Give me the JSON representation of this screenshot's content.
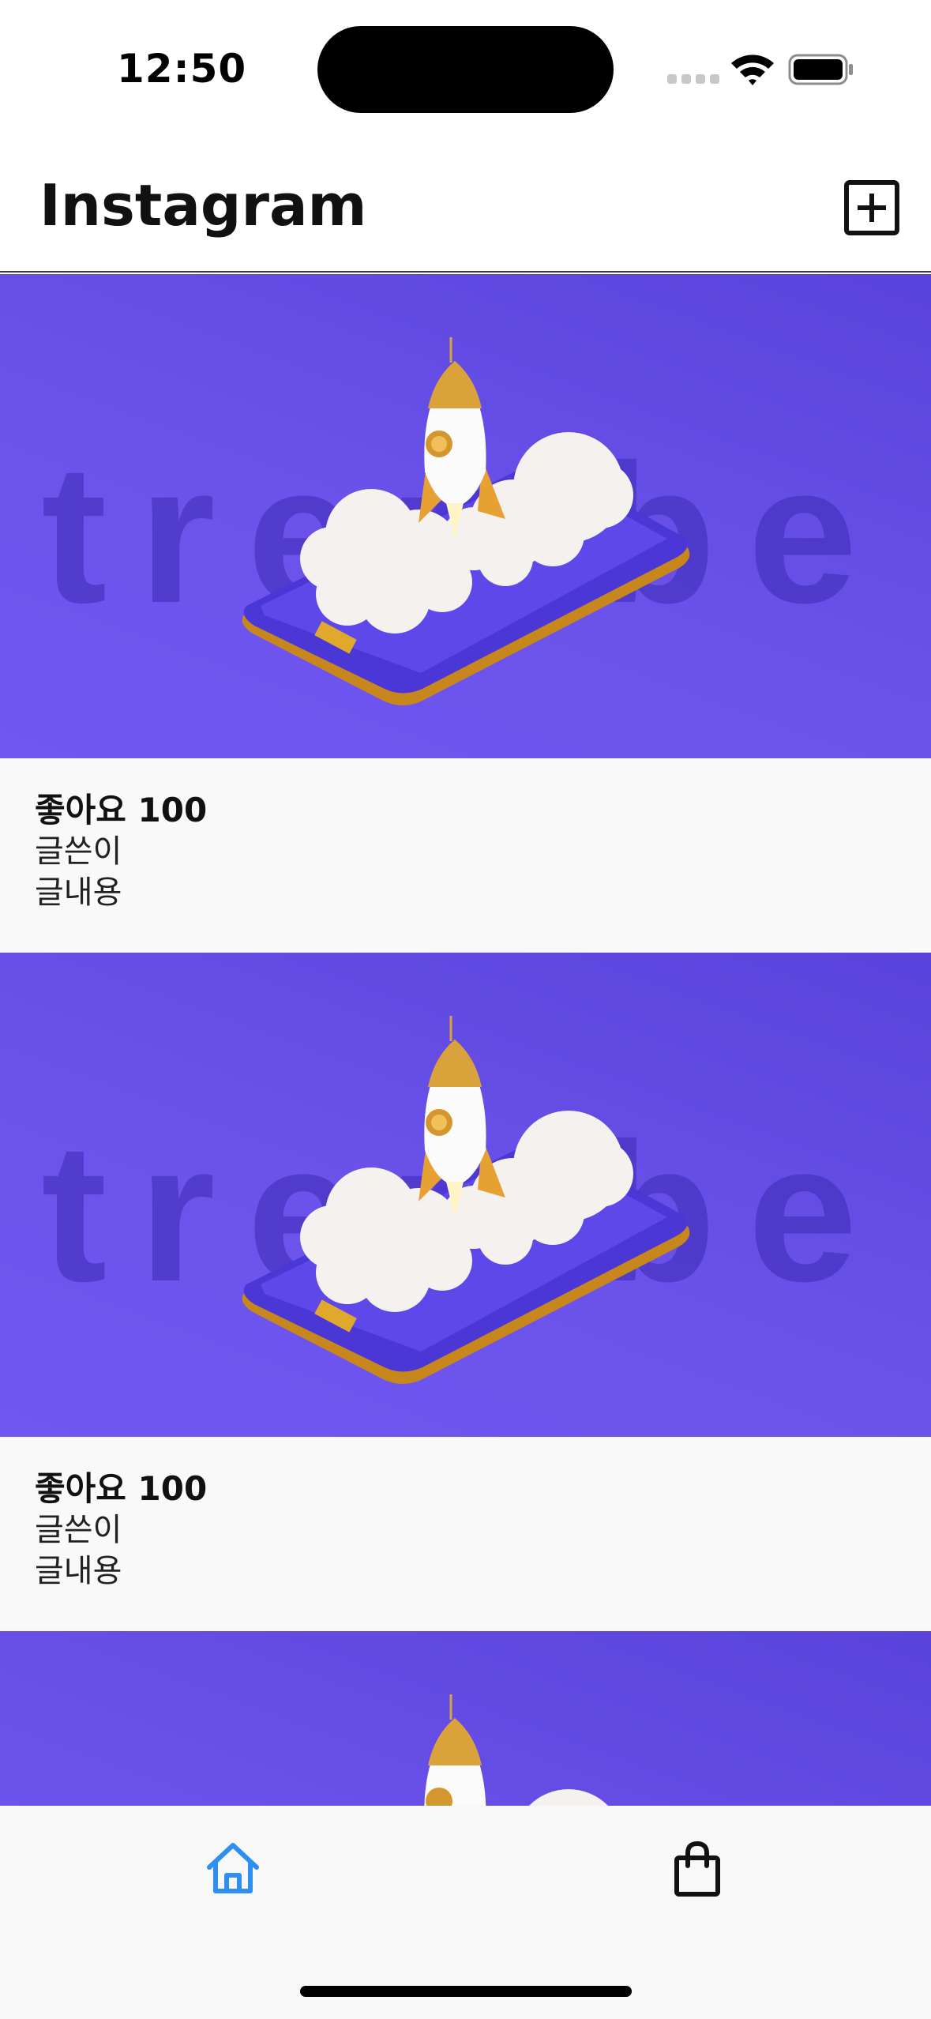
{
  "status_bar": {
    "time": "12:50"
  },
  "header": {
    "title": "Instagram"
  },
  "posts": [
    {
      "likes": "좋아요 100",
      "author": "글쓴이",
      "content": "글내용",
      "image_text": "trembe"
    },
    {
      "likes": "좋아요 100",
      "author": "글쓴이",
      "content": "글내용",
      "image_text": "trembe"
    }
  ],
  "tab_bar": {
    "items": [
      {
        "name": "home",
        "icon": "home-icon",
        "active": true
      },
      {
        "name": "shop",
        "icon": "shopping-bag-icon",
        "active": false
      }
    ]
  },
  "colors": {
    "accent": "#2e8ff0",
    "image_bg": "#6a52ea",
    "text": "#111111"
  }
}
